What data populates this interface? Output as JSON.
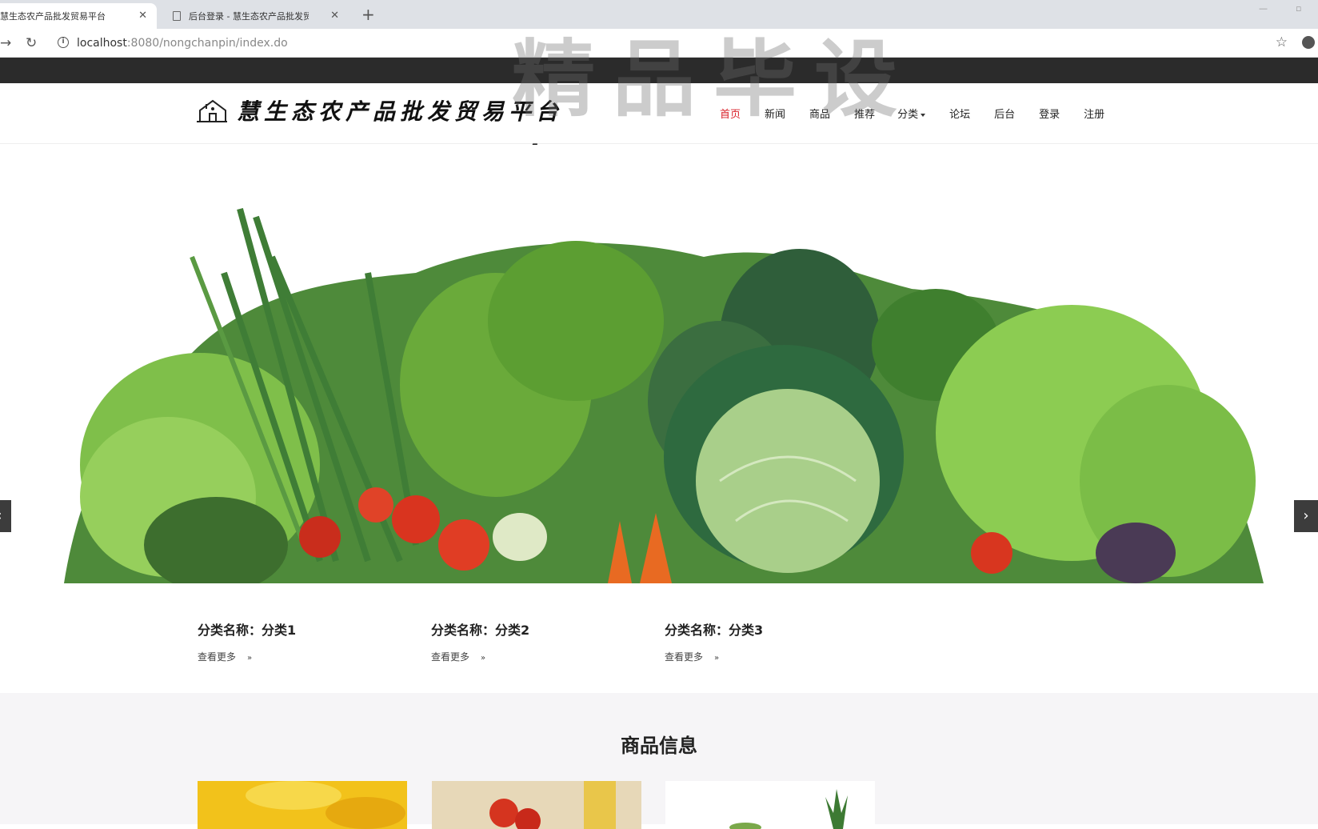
{
  "browser": {
    "tabs": [
      {
        "title": "慧生态农产品批发贸易平台",
        "close": "✕"
      },
      {
        "title": "后台登录 - 慧生态农产品批发贸易",
        "close": "✕"
      }
    ],
    "new_tab": "+",
    "url_host": "localhost",
    "url_rest": ":8080/nongchanpin/index.do",
    "watermark": "精品毕设"
  },
  "site": {
    "logo_text": "慧生态农产品批发贸易平台",
    "nav": [
      {
        "label": "首页",
        "active": true
      },
      {
        "label": "新闻"
      },
      {
        "label": "商品"
      },
      {
        "label": "推荐"
      },
      {
        "label": "分类"
      },
      {
        "label": "论坛"
      },
      {
        "label": "后台"
      },
      {
        "label": "登录"
      },
      {
        "label": "注册"
      }
    ]
  },
  "banner": {
    "prev": "‹",
    "next": "›"
  },
  "categories": [
    {
      "name": "分类名称：分类1",
      "more": "查看更多",
      "arrow": "»"
    },
    {
      "name": "分类名称：分类2",
      "more": "查看更多",
      "arrow": "»"
    },
    {
      "name": "分类名称：分类3",
      "more": "查看更多",
      "arrow": "»"
    }
  ],
  "products": {
    "title": "商品信息"
  },
  "colors": {
    "accent": "#d9212a",
    "dark_strip": "#2b2b2b"
  }
}
